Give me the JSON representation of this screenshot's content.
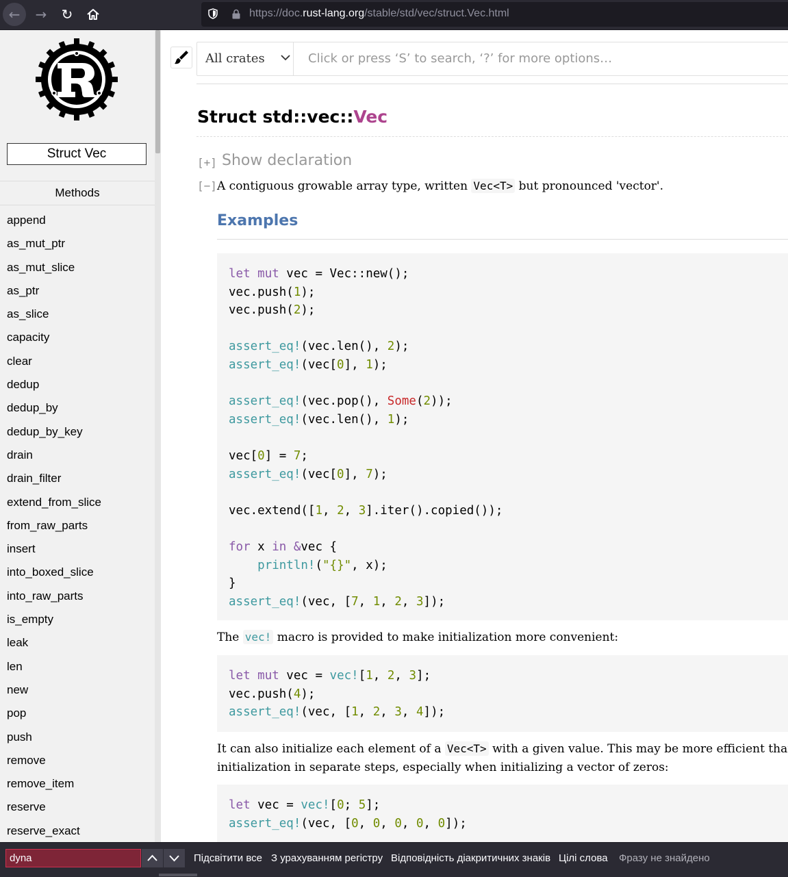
{
  "browser": {
    "url_prefix": "https://doc.",
    "url_domain": "rust-lang.org",
    "url_path": "/stable/std/vec/struct.Vec.html"
  },
  "sidebar": {
    "struct_label": "Struct Vec",
    "section_title": "Methods",
    "methods": [
      "append",
      "as_mut_ptr",
      "as_mut_slice",
      "as_ptr",
      "as_slice",
      "capacity",
      "clear",
      "dedup",
      "dedup_by",
      "dedup_by_key",
      "drain",
      "drain_filter",
      "extend_from_slice",
      "from_raw_parts",
      "insert",
      "into_boxed_slice",
      "into_raw_parts",
      "is_empty",
      "leak",
      "len",
      "new",
      "pop",
      "push",
      "remove",
      "remove_item",
      "reserve",
      "reserve_exact"
    ]
  },
  "search": {
    "crates_label": "All crates",
    "placeholder": "Click or press ‘S’ to search, ‘?’ for more options…"
  },
  "page": {
    "title_prefix": "Struct std::vec::",
    "title_name": "Vec",
    "expand_toggle": "[+]",
    "collapse_toggle": "[−]",
    "show_declaration": "Show declaration",
    "summary_before": "A contiguous growable array type, written ",
    "summary_code": "Vec<T>",
    "summary_after": " but pronounced 'vector'.",
    "examples_heading": "Examples",
    "vec_macro_before": "The ",
    "vec_macro_code": "vec!",
    "vec_macro_after": " macro is provided to make initialization more convenient:",
    "init_line1_before": "It can also initialize each element of a ",
    "init_line1_code": "Vec<T>",
    "init_line1_after": " with a given value. This may be more efficient than p",
    "init_line2": "initialization in separate steps, especially when initializing a vector of zeros:"
  },
  "code_blocks": [
    [
      [
        [
          "kw",
          "let"
        ],
        [
          "p",
          " "
        ],
        [
          "kw",
          "mut"
        ],
        [
          "p",
          " vec = Vec::new();"
        ]
      ],
      [
        [
          "p",
          "vec.push("
        ],
        [
          "num",
          "1"
        ],
        [
          "p",
          ");"
        ]
      ],
      [
        [
          "p",
          "vec.push("
        ],
        [
          "num",
          "2"
        ],
        [
          "p",
          ");"
        ]
      ],
      [],
      [
        [
          "mac",
          "assert_eq!"
        ],
        [
          "p",
          "(vec.len(), "
        ],
        [
          "num",
          "2"
        ],
        [
          "p",
          ");"
        ]
      ],
      [
        [
          "mac",
          "assert_eq!"
        ],
        [
          "p",
          "(vec["
        ],
        [
          "num",
          "0"
        ],
        [
          "p",
          "], "
        ],
        [
          "num",
          "1"
        ],
        [
          "p",
          ");"
        ]
      ],
      [],
      [
        [
          "mac",
          "assert_eq!"
        ],
        [
          "p",
          "(vec.pop(), "
        ],
        [
          "ty",
          "Some"
        ],
        [
          "p",
          "("
        ],
        [
          "num",
          "2"
        ],
        [
          "p",
          "));"
        ]
      ],
      [
        [
          "mac",
          "assert_eq!"
        ],
        [
          "p",
          "(vec.len(), "
        ],
        [
          "num",
          "1"
        ],
        [
          "p",
          ");"
        ]
      ],
      [],
      [
        [
          "p",
          "vec["
        ],
        [
          "num",
          "0"
        ],
        [
          "p",
          "] = "
        ],
        [
          "num",
          "7"
        ],
        [
          "p",
          ";"
        ]
      ],
      [
        [
          "mac",
          "assert_eq!"
        ],
        [
          "p",
          "(vec["
        ],
        [
          "num",
          "0"
        ],
        [
          "p",
          "], "
        ],
        [
          "num",
          "7"
        ],
        [
          "p",
          ");"
        ]
      ],
      [],
      [
        [
          "p",
          "vec.extend(["
        ],
        [
          "num",
          "1"
        ],
        [
          "p",
          ", "
        ],
        [
          "num",
          "2"
        ],
        [
          "p",
          ", "
        ],
        [
          "num",
          "3"
        ],
        [
          "p",
          "].iter().copied());"
        ]
      ],
      [],
      [
        [
          "kw",
          "for"
        ],
        [
          "p",
          " x "
        ],
        [
          "kw",
          "in"
        ],
        [
          "p",
          " "
        ],
        [
          "kw",
          "&"
        ],
        [
          "p",
          "vec {"
        ]
      ],
      [
        [
          "p",
          "    "
        ],
        [
          "mac",
          "println!"
        ],
        [
          "p",
          "("
        ],
        [
          "str",
          "\"{}\""
        ],
        [
          "p",
          ", x);"
        ]
      ],
      [
        [
          "p",
          "}"
        ]
      ],
      [
        [
          "mac",
          "assert_eq!"
        ],
        [
          "p",
          "(vec, ["
        ],
        [
          "num",
          "7"
        ],
        [
          "p",
          ", "
        ],
        [
          "num",
          "1"
        ],
        [
          "p",
          ", "
        ],
        [
          "num",
          "2"
        ],
        [
          "p",
          ", "
        ],
        [
          "num",
          "3"
        ],
        [
          "p",
          "]);"
        ]
      ]
    ],
    [
      [
        [
          "kw",
          "let"
        ],
        [
          "p",
          " "
        ],
        [
          "kw",
          "mut"
        ],
        [
          "p",
          " vec = "
        ],
        [
          "mac",
          "vec!"
        ],
        [
          "p",
          "["
        ],
        [
          "num",
          "1"
        ],
        [
          "p",
          ", "
        ],
        [
          "num",
          "2"
        ],
        [
          "p",
          ", "
        ],
        [
          "num",
          "3"
        ],
        [
          "p",
          "];"
        ]
      ],
      [
        [
          "p",
          "vec.push("
        ],
        [
          "num",
          "4"
        ],
        [
          "p",
          ");"
        ]
      ],
      [
        [
          "mac",
          "assert_eq!"
        ],
        [
          "p",
          "(vec, ["
        ],
        [
          "num",
          "1"
        ],
        [
          "p",
          ", "
        ],
        [
          "num",
          "2"
        ],
        [
          "p",
          ", "
        ],
        [
          "num",
          "3"
        ],
        [
          "p",
          ", "
        ],
        [
          "num",
          "4"
        ],
        [
          "p",
          "]);"
        ]
      ]
    ],
    [
      [
        [
          "kw",
          "let"
        ],
        [
          "p",
          " vec = "
        ],
        [
          "mac",
          "vec!"
        ],
        [
          "p",
          "["
        ],
        [
          "num",
          "0"
        ],
        [
          "p",
          "; "
        ],
        [
          "num",
          "5"
        ],
        [
          "p",
          "];"
        ]
      ],
      [
        [
          "mac",
          "assert_eq!"
        ],
        [
          "p",
          "(vec, ["
        ],
        [
          "num",
          "0"
        ],
        [
          "p",
          ", "
        ],
        [
          "num",
          "0"
        ],
        [
          "p",
          ", "
        ],
        [
          "num",
          "0"
        ],
        [
          "p",
          ", "
        ],
        [
          "num",
          "0"
        ],
        [
          "p",
          ", "
        ],
        [
          "num",
          "0"
        ],
        [
          "p",
          "]);"
        ]
      ]
    ]
  ],
  "findbar": {
    "query": "dyna",
    "highlight_all": "Підсвітити все",
    "match_case": "З урахуванням регістру",
    "match_diacritics": "Відповідність діакритичних знаків",
    "whole_words": "Цілі слова",
    "status": "Фразу не знайдено"
  }
}
